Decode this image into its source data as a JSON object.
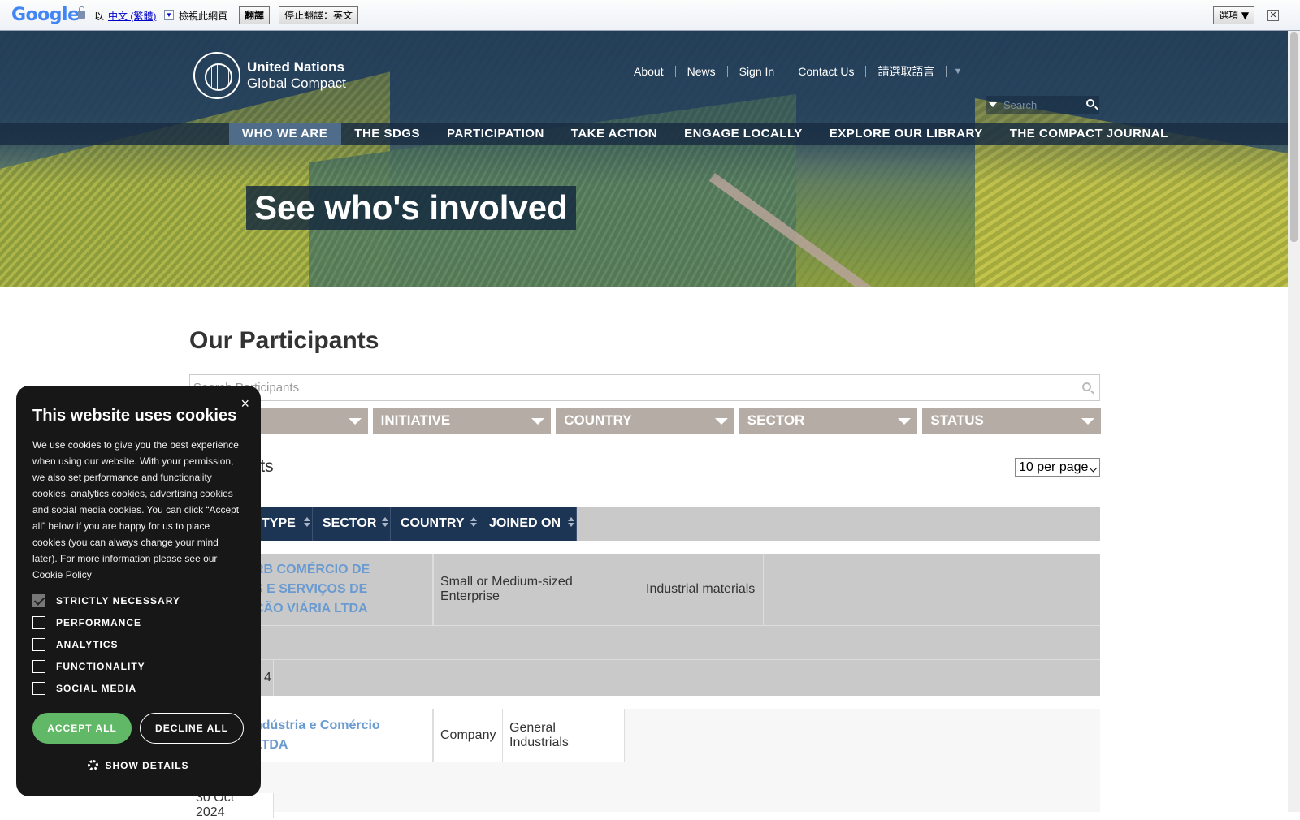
{
  "translate_bar": {
    "logo": "Google",
    "prefix": "以",
    "language": "中文 (繁體)",
    "view_text": "檢視此網頁",
    "translate_button": "翻譯",
    "stop_button": "停止翻譯：英文",
    "options_button": "選項 ▼",
    "close": "✕"
  },
  "header": {
    "logo_line1": "United Nations",
    "logo_line2": "Global Compact",
    "top_nav": [
      "About",
      "News",
      "Sign In",
      "Contact Us"
    ],
    "language_select": "請選取語言",
    "language_arrow": "▼",
    "search_placeholder": "Search",
    "main_nav": [
      "WHO WE ARE",
      "THE SDGS",
      "PARTICIPATION",
      "TAKE ACTION",
      "ENGAGE LOCALLY",
      "EXPLORE OUR LIBRARY",
      "THE COMPACT JOURNAL"
    ],
    "hero_title": "See who's involved"
  },
  "main": {
    "page_title": "Our Participants",
    "search_placeholder": "Search Participants",
    "filters": [
      "",
      "INITIATIVE",
      "COUNTRY",
      "SECTOR",
      "STATUS"
    ],
    "results_text": "ults",
    "per_page": "10 per page",
    "columns": [
      "TYPE",
      "SECTOR",
      "COUNTRY",
      "JOINED ON"
    ],
    "rows": [
      {
        "name": "RB COMÉRCIO DE\nS E SERVIÇOS DE\nÇÃO VIÁRIA LTDA",
        "type": "Small or Medium-sized Enterprise",
        "sector": "Industrial materials",
        "joined": "4"
      },
      {
        "name": "ndústria e Comércio\nLTDA",
        "type": "Company",
        "sector": "General Industrials",
        "joined": "30 Oct 2024"
      }
    ]
  },
  "cookie": {
    "close": "×",
    "title": "This website uses cookies",
    "text": "We use cookies to give you the best experience when using our website.  With your permission, we also set performance and functionality cookies, analytics cookies, advertising cookies and social media cookies.  You can click “Accept all” below if you are happy for us to place cookies (you can always change your mind later).  For more information please see our Cookie Policy",
    "options": [
      {
        "label": "STRICTLY NECESSARY",
        "checked": true
      },
      {
        "label": "PERFORMANCE",
        "checked": false
      },
      {
        "label": "ANALYTICS",
        "checked": false
      },
      {
        "label": "FUNCTIONALITY",
        "checked": false
      },
      {
        "label": "SOCIAL MEDIA",
        "checked": false
      }
    ],
    "accept": "ACCEPT ALL",
    "decline": "DECLINE ALL",
    "details": "SHOW DETAILS"
  }
}
